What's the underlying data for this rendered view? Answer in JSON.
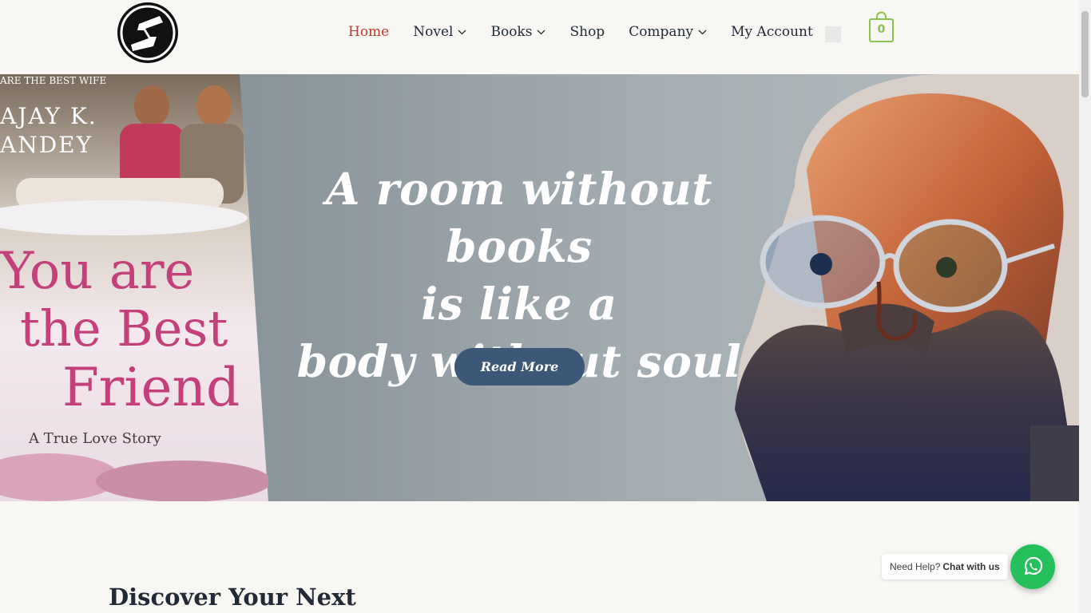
{
  "nav": {
    "items": [
      {
        "label": "Home",
        "active": true,
        "has_dropdown": false
      },
      {
        "label": "Novel",
        "active": false,
        "has_dropdown": true
      },
      {
        "label": "Books",
        "active": false,
        "has_dropdown": true
      },
      {
        "label": "Shop",
        "active": false,
        "has_dropdown": false
      },
      {
        "label": "Company",
        "active": false,
        "has_dropdown": true
      },
      {
        "label": "My Account",
        "active": false,
        "has_dropdown": false
      }
    ]
  },
  "cart": {
    "count": "0",
    "icon": "shopping-bag-icon",
    "color": "#8bc34a"
  },
  "hero": {
    "quote_lines": [
      "A room without books",
      "is like a",
      "body without soul"
    ],
    "button_label": "Read More",
    "book_cover": {
      "author_line": "AJAY K. PANDEY",
      "tagline": "ARE THE BEST WIFE",
      "title_lines": [
        "You are",
        "the Best",
        "Friend"
      ],
      "subtitle": "A True Love Story"
    }
  },
  "section": {
    "title": "Discover Your Next"
  },
  "chat": {
    "prefix": "Need Help?",
    "label": "Chat with us",
    "icon": "whatsapp-icon"
  },
  "colors": {
    "accent": "#c0392b",
    "button": "#3c5878",
    "whatsapp": "#25c05c",
    "cart": "#8bc34a"
  }
}
